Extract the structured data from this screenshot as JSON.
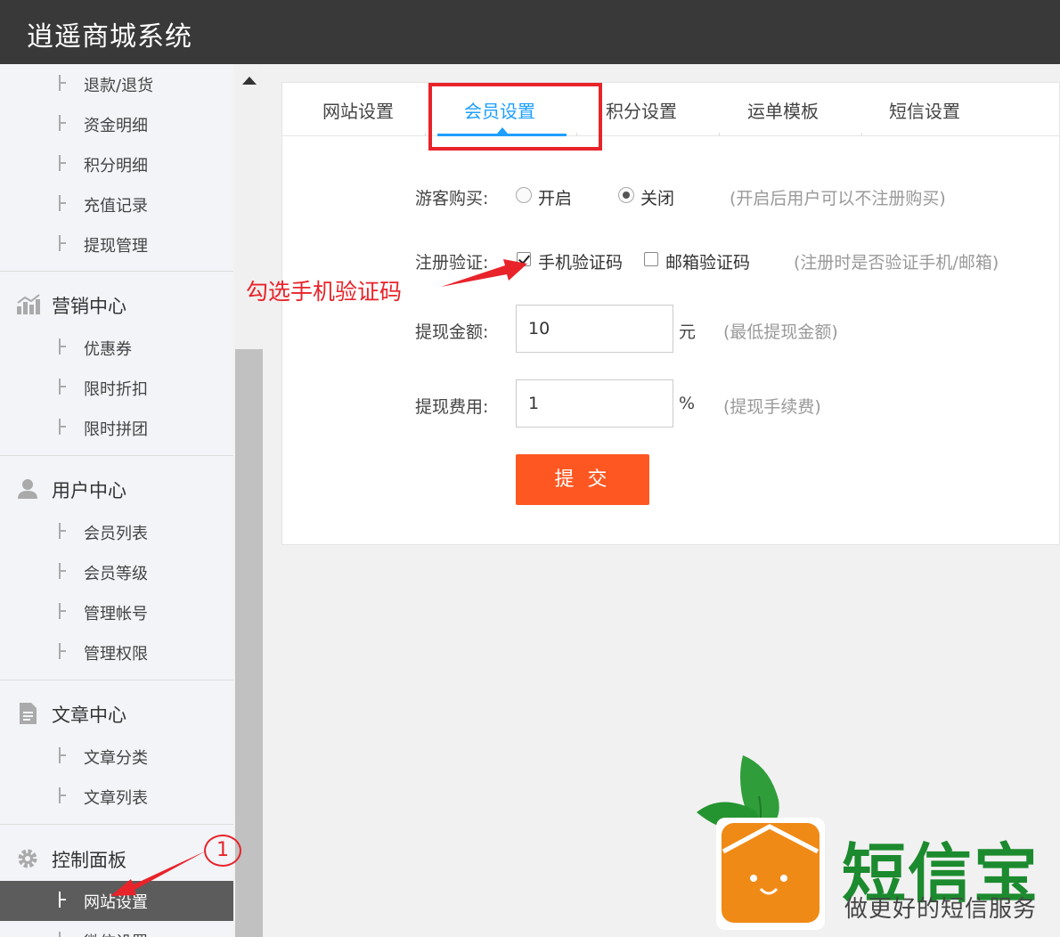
{
  "app": {
    "title": "逍遥商城系统"
  },
  "sidebar": {
    "finance_items": [
      "退款/退货",
      "资金明细",
      "积分明细",
      "充值记录",
      "提现管理"
    ],
    "marketing": {
      "label": "营销中心",
      "items": [
        "优惠券",
        "限时折扣",
        "限时拼团"
      ]
    },
    "users": {
      "label": "用户中心",
      "items": [
        "会员列表",
        "会员等级",
        "管理帐号",
        "管理权限"
      ]
    },
    "articles": {
      "label": "文章中心",
      "items": [
        "文章分类",
        "文章列表"
      ]
    },
    "control": {
      "label": "控制面板",
      "items": [
        "网站设置",
        "微信设置"
      ],
      "active_item": "网站设置"
    }
  },
  "tabs": [
    "网站设置",
    "会员设置",
    "积分设置",
    "运单模板",
    "短信设置"
  ],
  "active_tab": "会员设置",
  "form": {
    "guest_purchase": {
      "label": "游客购买:",
      "options": [
        "开启",
        "关闭"
      ],
      "selected": "关闭",
      "hint": "(开启后用户可以不注册购买)"
    },
    "register_verify": {
      "label": "注册验证:",
      "options": [
        {
          "label": "手机验证码",
          "checked": true
        },
        {
          "label": "邮箱验证码",
          "checked": false
        }
      ],
      "hint": "(注册时是否验证手机/邮箱)"
    },
    "withdraw_amount": {
      "label": "提现金额:",
      "value": "10",
      "unit": "元",
      "hint": "(最低提现金额)"
    },
    "withdraw_fee": {
      "label": "提现费用:",
      "value": "1",
      "unit": "%",
      "hint": "(提现手续费)"
    },
    "submit_label": "提 交"
  },
  "annotations": {
    "arrow_text": "勾选手机验证码",
    "step_marker": "1",
    "color": "#e8232a"
  },
  "brand": {
    "name": "短信宝",
    "slogan": "做更好的短信服务"
  },
  "colors": {
    "accent": "#1e9fff",
    "submit": "#ff5722",
    "topbar": "#393939",
    "sidebar_active": "#5c5c5c",
    "brand_green": "#1c8a2e"
  }
}
